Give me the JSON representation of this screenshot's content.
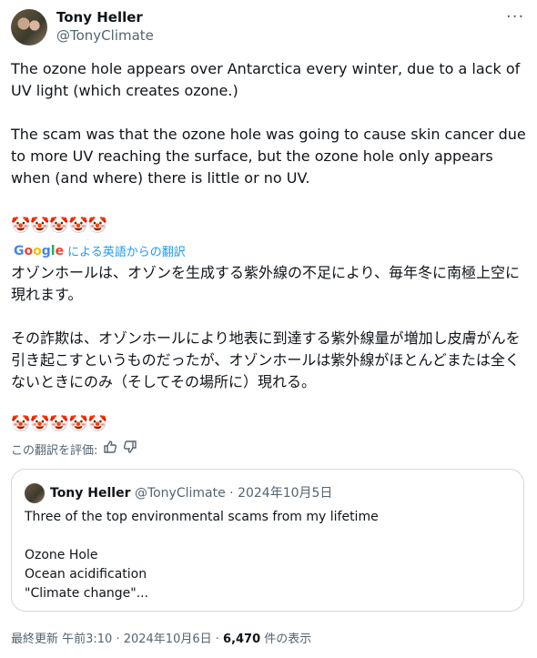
{
  "author": {
    "name": "Tony Heller",
    "handle": "@TonyClimate"
  },
  "more_icon": "more-horizontal-icon",
  "tweet": {
    "paragraph1": "The ozone hole appears over Antarctica every winter, due to a lack of UV light (which creates ozone.)",
    "paragraph2": "The scam was that the ozone hole was going to cause skin cancer due to more UV reaching the surface, but the ozone hole only appears when (and where) there is little or no UV.",
    "emojis": "🤡🤡🤡🤡🤡"
  },
  "translation": {
    "provider": "Google",
    "label": "による英語からの翻訳",
    "paragraph1": "オゾンホールは、オゾンを生成する紫外線の不足により、毎年冬に南極上空に現れます。",
    "paragraph2": "その詐欺は、オゾンホールにより地表に到達する紫外線量が増加し皮膚がんを引き起こすというものだったが、オゾンホールは紫外線がほとんどまたは全くないときにのみ（そしてその場所に）現れる。",
    "emojis": "🤡🤡🤡🤡🤡",
    "rate_label": "この翻訳を評価:"
  },
  "quote": {
    "name": "Tony Heller",
    "handle": "@TonyClimate",
    "sep": "·",
    "date": "2024年10月5日",
    "text": "Three of the top environmental scams from my lifetime\n\nOzone Hole\nOcean acidification\n\"Climate change\"..."
  },
  "footer": {
    "updated": "最終更新 午前3:10 · 2024年10月6日 · ",
    "views": "6,470",
    "views_label": " 件の表示"
  }
}
